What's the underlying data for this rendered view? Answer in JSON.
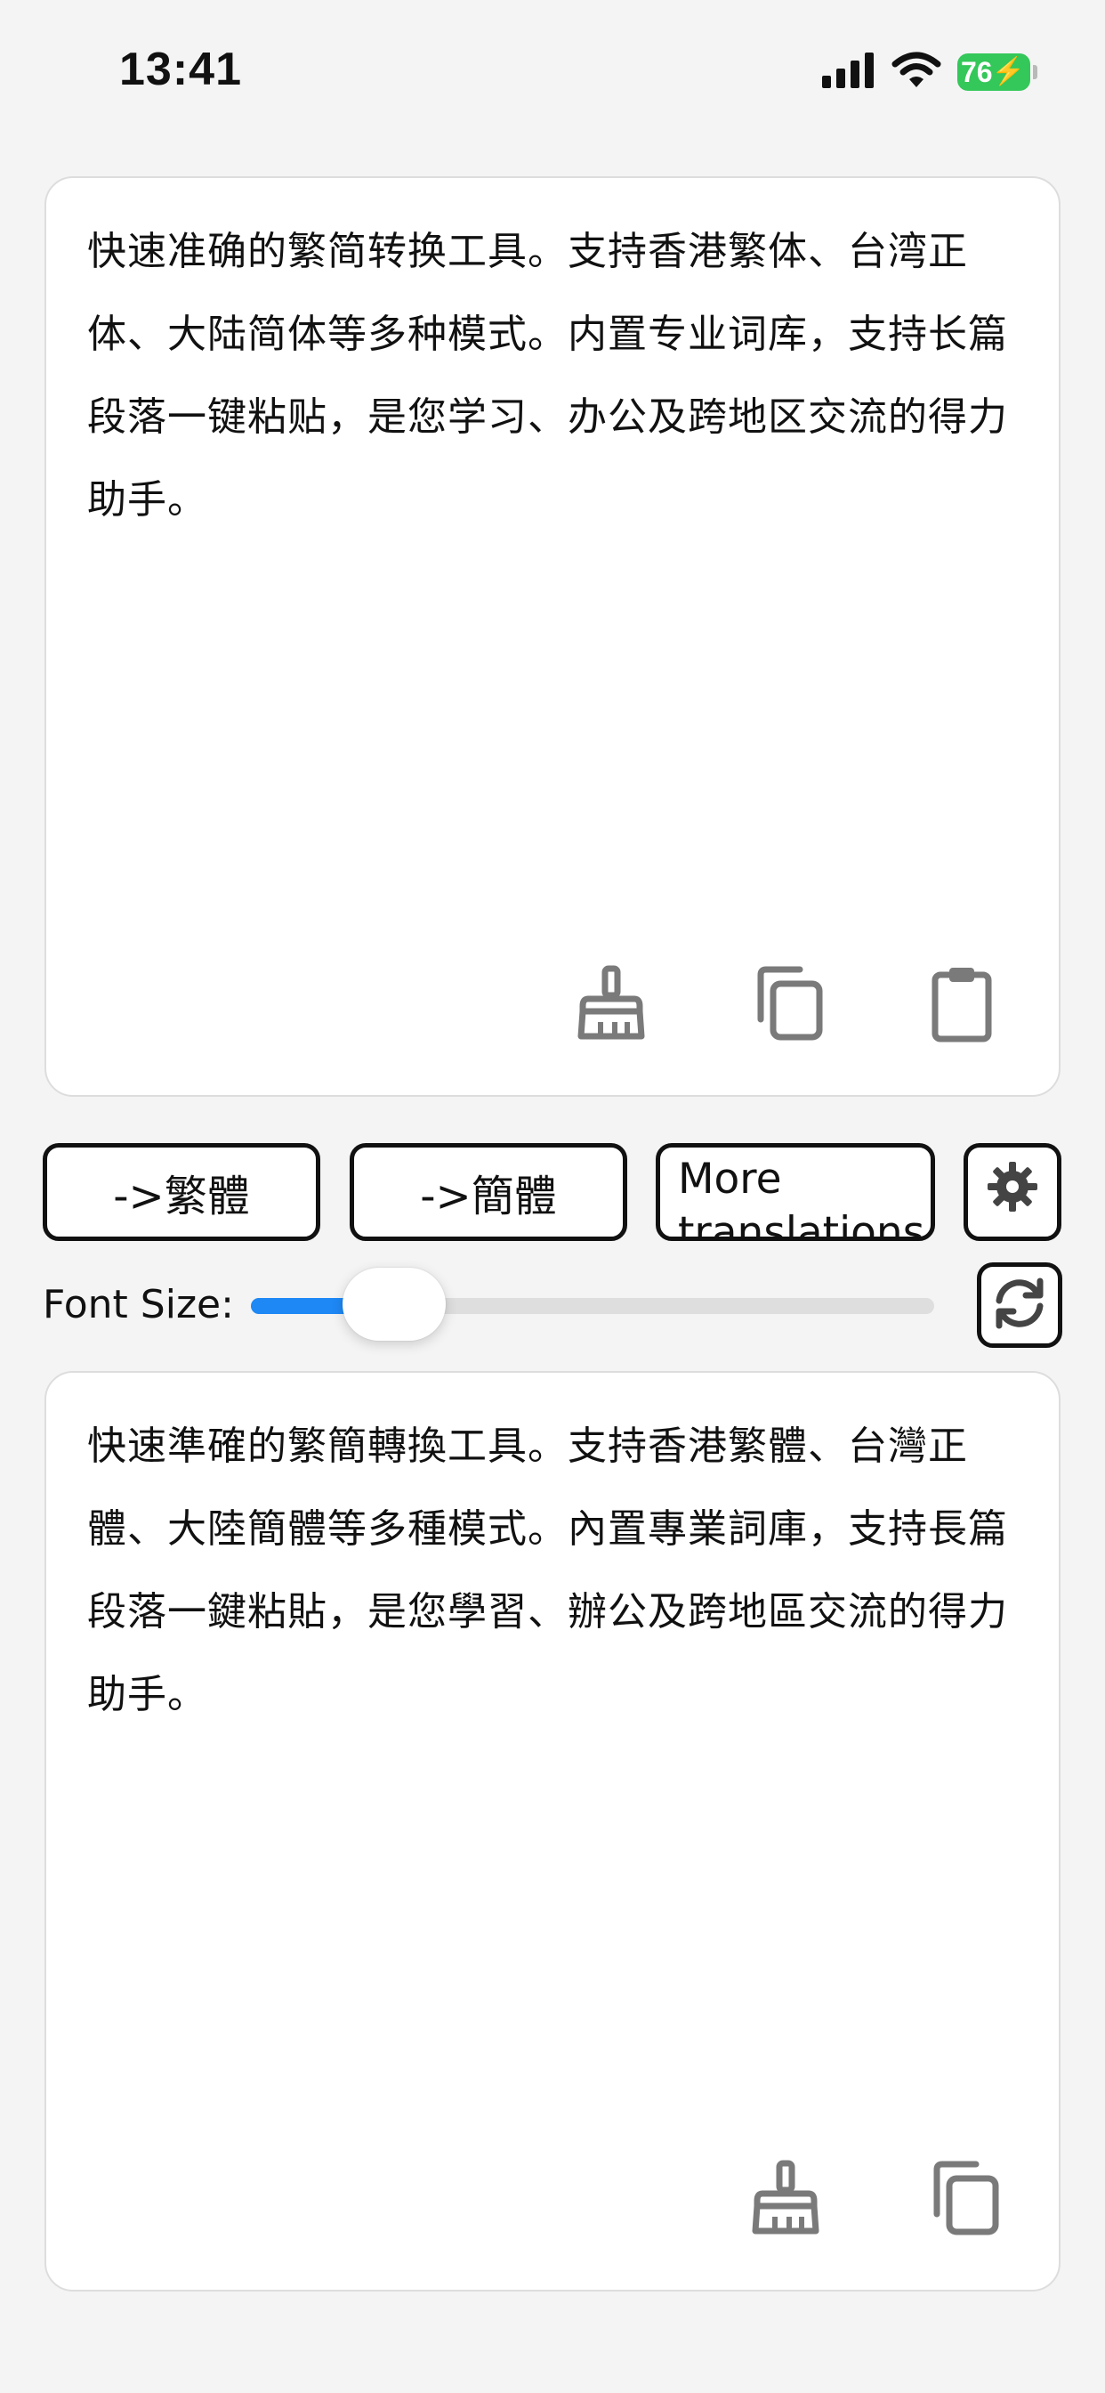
{
  "status_bar": {
    "time": "13:41",
    "battery_level": "76",
    "icons": [
      "signal-icon",
      "wifi-icon",
      "battery-icon",
      "charging-bolt-icon"
    ]
  },
  "source_panel": {
    "text": "快速准确的繁简转换工具。支持香港繁体、台湾正体、大陆简体等多种模式。内置专业词库，支持长篇段落一键粘贴，是您学习、办公及跨地区交流的得力助手。",
    "actions": [
      "clear-broom-icon",
      "copy-icon",
      "paste-clipboard-icon"
    ]
  },
  "conversion": {
    "to_traditional_label": "->繁體",
    "to_simplified_label": "->簡體",
    "more_label": "More\ntranslations",
    "settings_icon": "gear-icon"
  },
  "font_size": {
    "label": "Font Size:",
    "value_fraction": 0.21,
    "reset_icon": "refresh-icon"
  },
  "result_panel": {
    "text": "快速準確的繁簡轉換工具。支持香港繁體、台灣正體、大陸簡體等多種模式。內置專業詞庫，支持長篇段落一鍵粘貼，是您學習、辦公及跨地區交流的得力助手。",
    "actions": [
      "clear-broom-icon",
      "copy-icon"
    ]
  },
  "colors": {
    "accent": "#1e88f5",
    "battery": "#34c759",
    "background": "#f4f4f4"
  }
}
